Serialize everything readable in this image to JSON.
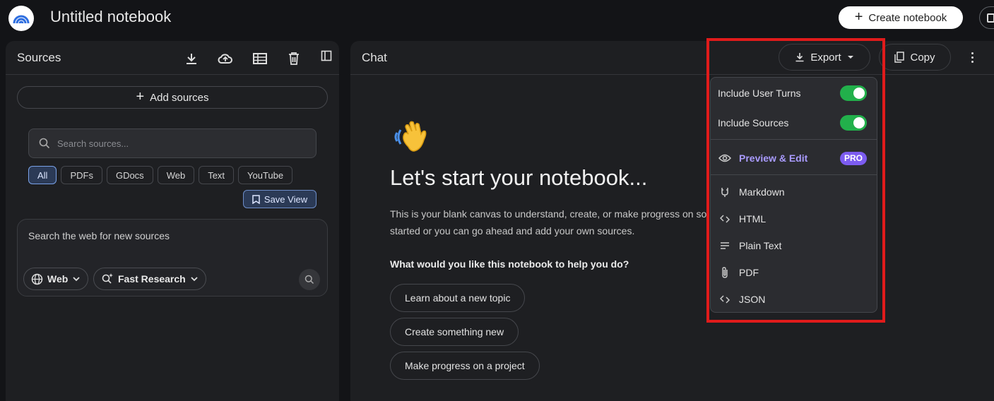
{
  "header": {
    "title": "Untitled notebook",
    "create_label": "Create notebook"
  },
  "sources": {
    "title": "Sources",
    "add_label": "Add sources",
    "search_placeholder": "Search sources...",
    "filters": [
      "All",
      "PDFs",
      "GDocs",
      "Web",
      "Text",
      "YouTube"
    ],
    "active_filter": "All",
    "save_view_label": "Save View",
    "web_search": {
      "hint": "Search the web for new sources",
      "web_label": "Web",
      "mode_label": "Fast Research"
    }
  },
  "chat": {
    "title": "Chat",
    "export_label": "Export",
    "copy_label": "Copy",
    "headline": "Let's start your notebook...",
    "intro_line1": "This is your blank canvas to understand, create, or make progress on so",
    "intro_line2": "started or you can go ahead and add your own sources.",
    "question": "What would you like this notebook to help you do?",
    "suggestions": [
      "Learn about a new topic",
      "Create something new",
      "Make progress on a project"
    ]
  },
  "export_menu": {
    "include_user_turns": "Include User Turns",
    "include_sources": "Include Sources",
    "include_user_turns_on": true,
    "include_sources_on": true,
    "preview_label": "Preview & Edit",
    "pro_badge": "PRO",
    "formats": [
      "Markdown",
      "HTML",
      "Plain Text",
      "PDF",
      "JSON"
    ]
  },
  "colors": {
    "background": "#131417",
    "panel": "#1e1f22",
    "toggle_on": "#22b04b",
    "pro_badge": "#7c5cf0",
    "highlight_box": "#e01b1b"
  }
}
